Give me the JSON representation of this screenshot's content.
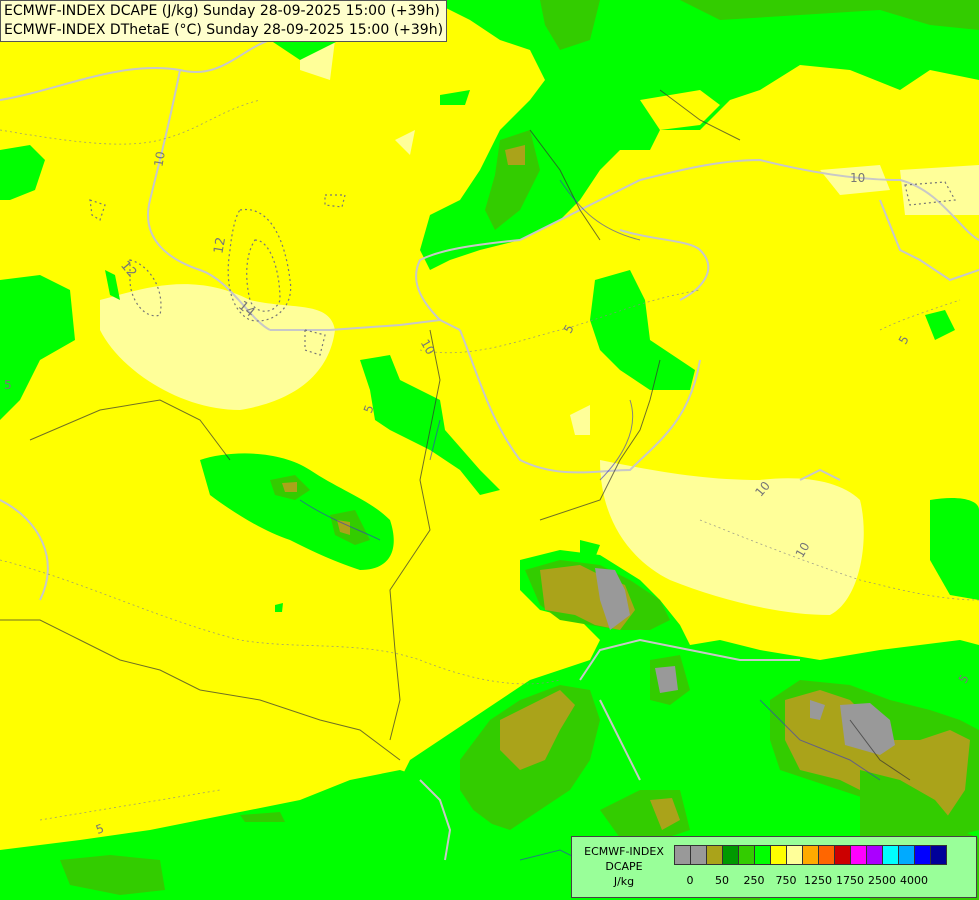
{
  "header": {
    "line1": "ECMWF-INDEX DCAPE (J/kg) Sunday 28-09-2025 15:00 (+39h)",
    "line2": "ECMWF-INDEX DThetaE (°C) Sunday 28-09-2025 15:00 (+39h)"
  },
  "legend": {
    "title_line1": "ECMWF-INDEX",
    "title_line2": "DCAPE",
    "title_line3": "J/kg",
    "colors": [
      "#999999",
      "#999999",
      "#aaa31a",
      "#009900",
      "#33cc00",
      "#00ff00",
      "#ffff00",
      "#ffff99",
      "#ffaa00",
      "#ff6600",
      "#cc0000",
      "#ff00ff",
      "#aa00ff",
      "#00ffff",
      "#00aaff",
      "#0000ff",
      "#000099"
    ],
    "ticks": [
      "0",
      "50",
      "250",
      "750",
      "1250",
      "1750",
      "2500",
      "4000"
    ]
  },
  "contour_labels": [
    "10",
    "12",
    "12",
    "14",
    "10",
    "5",
    "5",
    "10",
    "10",
    "5",
    "10",
    "5",
    "5",
    "5"
  ]
}
